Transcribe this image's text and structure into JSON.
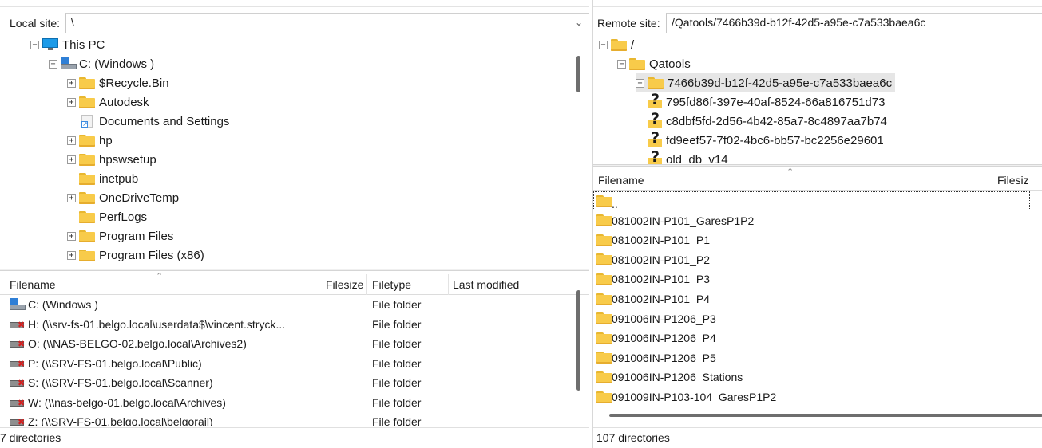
{
  "local": {
    "label": "Local site:",
    "path": "\\",
    "tree": [
      {
        "label": "This PC",
        "icon": "pc-icon",
        "level": 0,
        "exp": "-"
      },
      {
        "label": "C: (Windows )",
        "icon": "drive-icon",
        "level": 1,
        "exp": "-"
      },
      {
        "label": "$Recycle.Bin",
        "icon": "folder-icon",
        "level": 2,
        "exp": "+"
      },
      {
        "label": "Autodesk",
        "icon": "folder-icon",
        "level": 2,
        "exp": "+"
      },
      {
        "label": "Documents and Settings",
        "icon": "shortcut-icon",
        "level": 2,
        "exp": ""
      },
      {
        "label": "hp",
        "icon": "folder-icon",
        "level": 2,
        "exp": "+"
      },
      {
        "label": "hpswsetup",
        "icon": "folder-icon",
        "level": 2,
        "exp": "+"
      },
      {
        "label": "inetpub",
        "icon": "folder-icon",
        "level": 2,
        "exp": ""
      },
      {
        "label": "OneDriveTemp",
        "icon": "folder-icon",
        "level": 2,
        "exp": "+"
      },
      {
        "label": "PerfLogs",
        "icon": "folder-icon",
        "level": 2,
        "exp": ""
      },
      {
        "label": "Program Files",
        "icon": "folder-icon",
        "level": 2,
        "exp": "+"
      },
      {
        "label": "Program Files (x86)",
        "icon": "folder-icon",
        "level": 2,
        "exp": "+"
      }
    ],
    "columns": {
      "filename": "Filename",
      "filesize": "Filesize",
      "filetype": "Filetype",
      "modified": "Last modified"
    },
    "files": [
      {
        "name": "C: (Windows )",
        "type": "File folder",
        "icon": "drive-icon"
      },
      {
        "name": "H: (\\\\srv-fs-01.belgo.local\\userdata$\\vincent.stryck...",
        "type": "File folder",
        "icon": "network-drive-icon"
      },
      {
        "name": "O: (\\\\NAS-BELGO-02.belgo.local\\Archives2)",
        "type": "File folder",
        "icon": "network-drive-icon"
      },
      {
        "name": "P: (\\\\SRV-FS-01.belgo.local\\Public)",
        "type": "File folder",
        "icon": "network-drive-icon"
      },
      {
        "name": "S: (\\\\SRV-FS-01.belgo.local\\Scanner)",
        "type": "File folder",
        "icon": "network-drive-icon"
      },
      {
        "name": "W: (\\\\nas-belgo-01.belgo.local\\Archives)",
        "type": "File folder",
        "icon": "network-drive-icon"
      },
      {
        "name": "Z: (\\\\SRV-FS-01.belgo.local\\belgorail)",
        "type": "File folder",
        "icon": "network-drive-icon"
      }
    ],
    "status": "7 directories"
  },
  "remote": {
    "label": "Remote site:",
    "path": "/Qatools/7466b39d-b12f-42d5-a95e-c7a533baea6c",
    "tree": [
      {
        "label": "/",
        "icon": "folder-icon",
        "level": 0,
        "exp": "-"
      },
      {
        "label": "Qatools",
        "icon": "folder-icon",
        "level": 1,
        "exp": "-"
      },
      {
        "label": "7466b39d-b12f-42d5-a95e-c7a533baea6c",
        "icon": "folder-icon",
        "level": 2,
        "exp": "+",
        "selected": true
      },
      {
        "label": "795fd86f-397e-40af-8524-66a816751d73",
        "icon": "unknown-folder-icon",
        "level": 2,
        "exp": ""
      },
      {
        "label": "c8dbf5fd-2d56-4b42-85a7-8c4897aa7b74",
        "icon": "unknown-folder-icon",
        "level": 2,
        "exp": ""
      },
      {
        "label": "fd9eef57-7f02-4bc6-bb57-bc2256e29601",
        "icon": "unknown-folder-icon",
        "level": 2,
        "exp": ""
      },
      {
        "label": "old_db_v14",
        "icon": "unknown-folder-icon",
        "level": 2,
        "exp": ""
      }
    ],
    "columns": {
      "filename": "Filename",
      "filesize": "Filesiz"
    },
    "files": [
      "..",
      "081002IN-P101_GaresP1P2",
      "081002IN-P101_P1",
      "081002IN-P101_P2",
      "081002IN-P101_P3",
      "081002IN-P101_P4",
      "091006IN-P1206_P3",
      "091006IN-P1206_P4",
      "091006IN-P1206_P5",
      "091006IN-P1206_Stations",
      "091009IN-P103-104_GaresP1P2"
    ],
    "status": "107 directories"
  }
}
